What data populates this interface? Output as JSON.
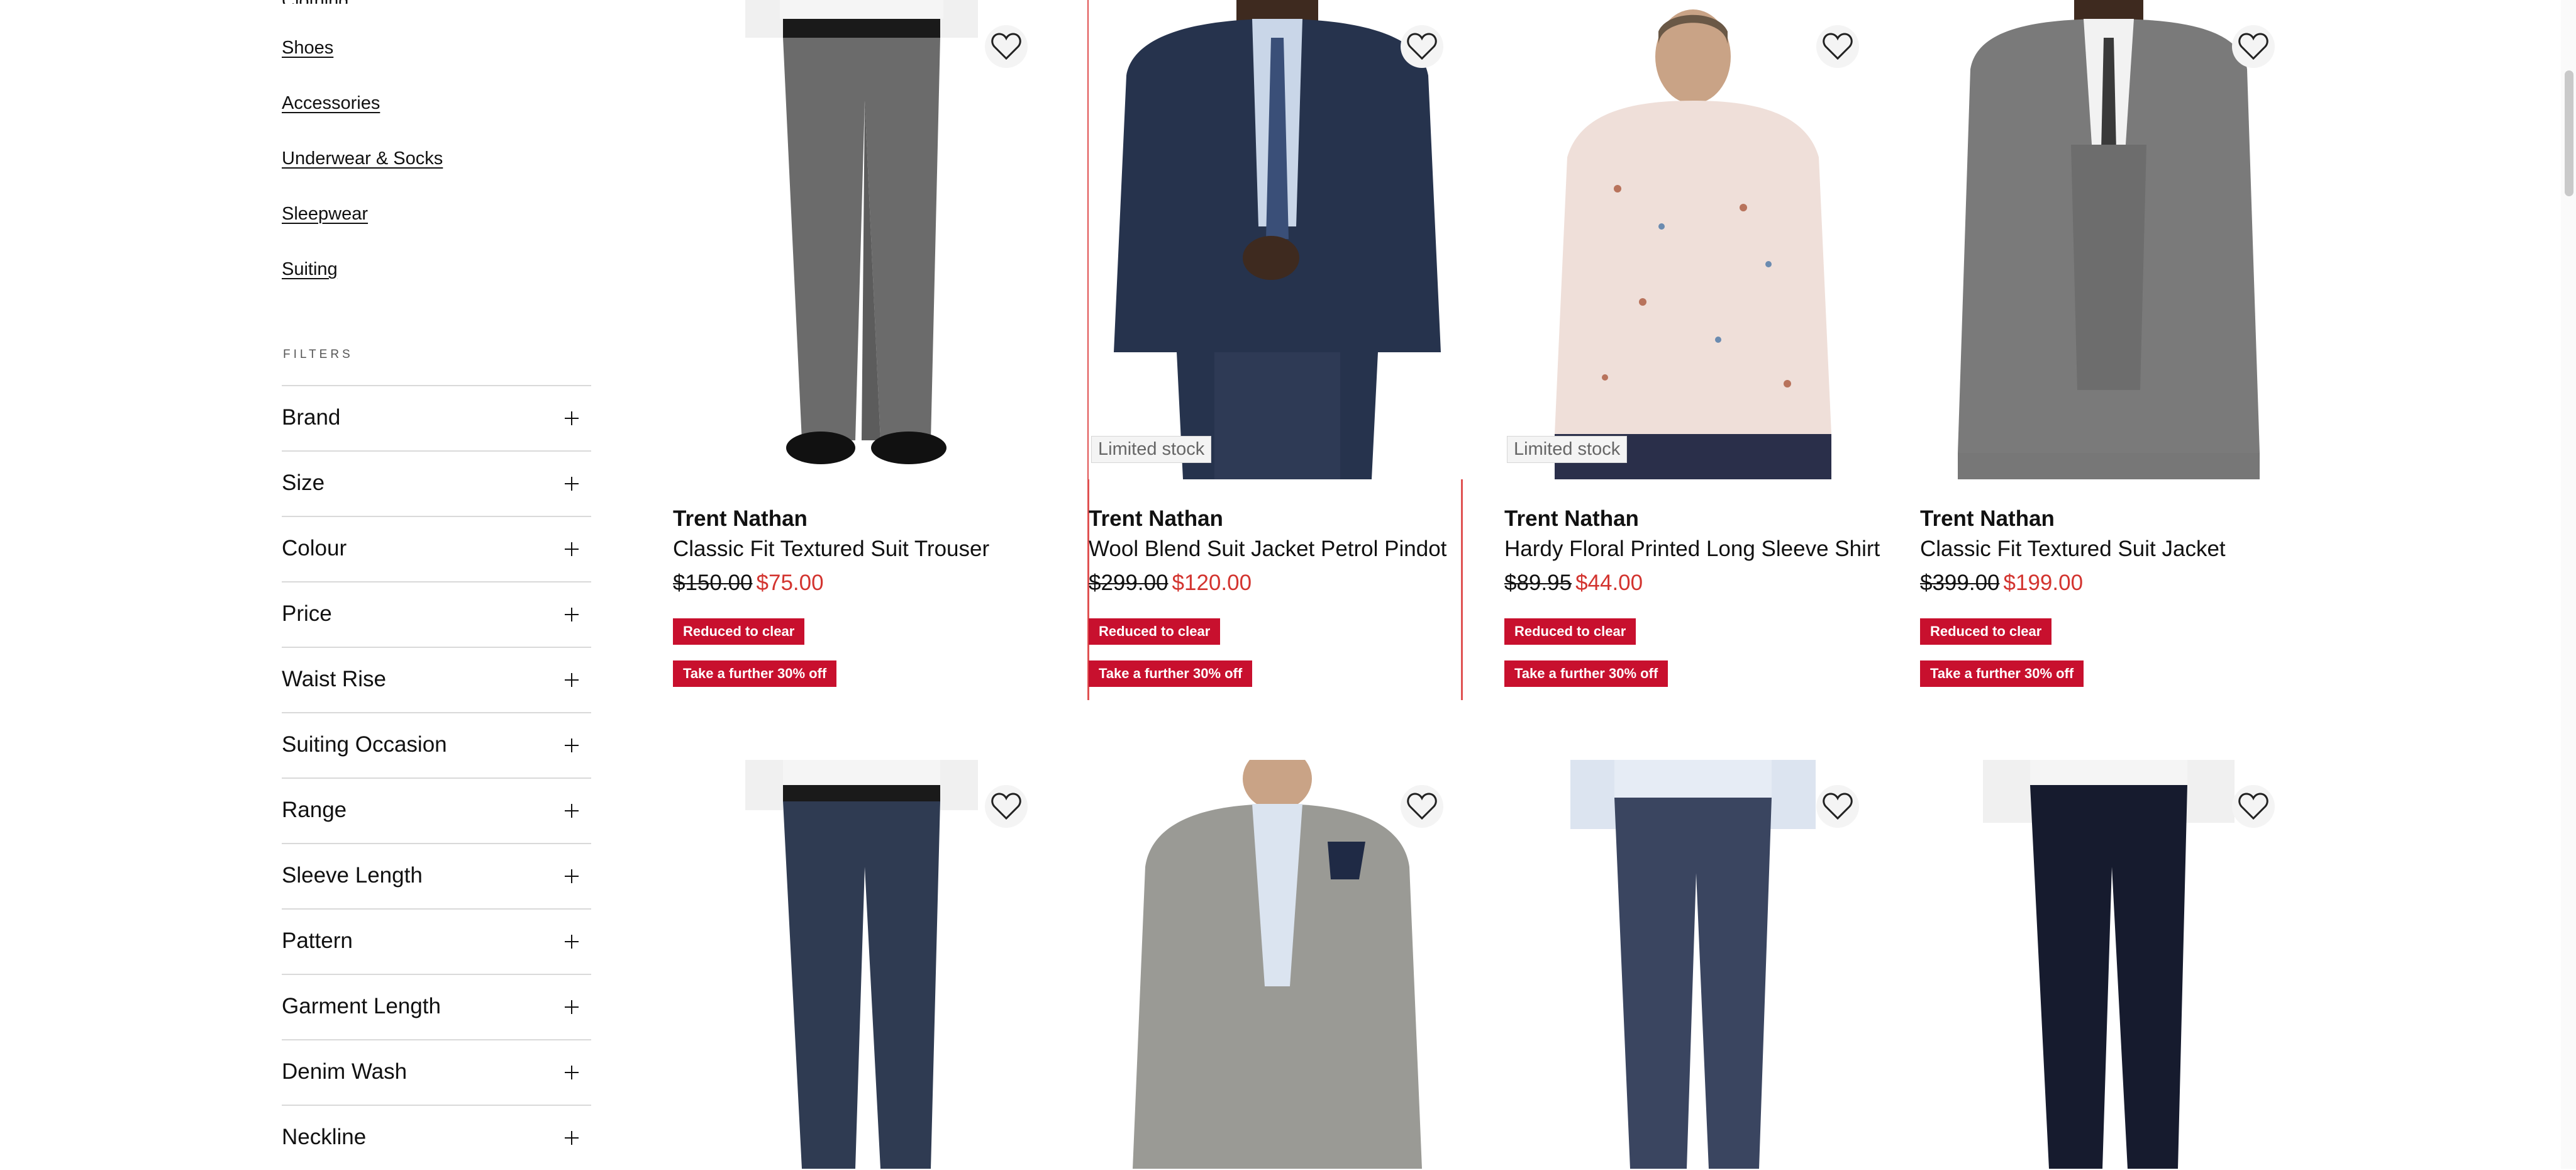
{
  "sidebar": {
    "categories": [
      "Shoes",
      "Accessories",
      "Underwear & Socks",
      "Sleepwear",
      "Suiting"
    ],
    "filters_heading": "FILTERS",
    "filters": [
      "Brand",
      "Size",
      "Colour",
      "Price",
      "Waist Rise",
      "Suiting Occasion",
      "Range",
      "Sleeve Length",
      "Pattern",
      "Garment Length",
      "Denim Wash",
      "Neckline"
    ]
  },
  "products": [
    {
      "brand": "Trent Nathan",
      "name": "Classic Fit Textured Suit Trouser",
      "was": "$150.00",
      "now": "$75.00",
      "badge1": "Reduced to clear",
      "badge2": "Take a further 30% off"
    },
    {
      "brand": "Trent Nathan",
      "name": "Wool Blend Suit Jacket Petrol Pindot",
      "was": "$299.00",
      "now": "$120.00",
      "stock": "Limited stock",
      "badge1": "Reduced to clear",
      "badge2": "Take a further 30% off"
    },
    {
      "brand": "Trent Nathan",
      "name": "Hardy Floral Printed Long Sleeve Shirt",
      "was": "$89.95",
      "now": "$44.00",
      "stock": "Limited stock",
      "badge1": "Reduced to clear",
      "badge2": "Take a further 30% off"
    },
    {
      "brand": "Trent Nathan",
      "name": "Classic Fit Textured Suit Jacket",
      "was": "$399.00",
      "now": "$199.00",
      "badge1": "Reduced to clear",
      "badge2": "Take a further 30% off"
    }
  ],
  "colors": {
    "sale_red": "#d3342f",
    "badge_red": "#c8102e",
    "focus_outline": "#e05252"
  },
  "icons": {
    "wishlist": "heart-icon",
    "expand": "plus-icon"
  }
}
